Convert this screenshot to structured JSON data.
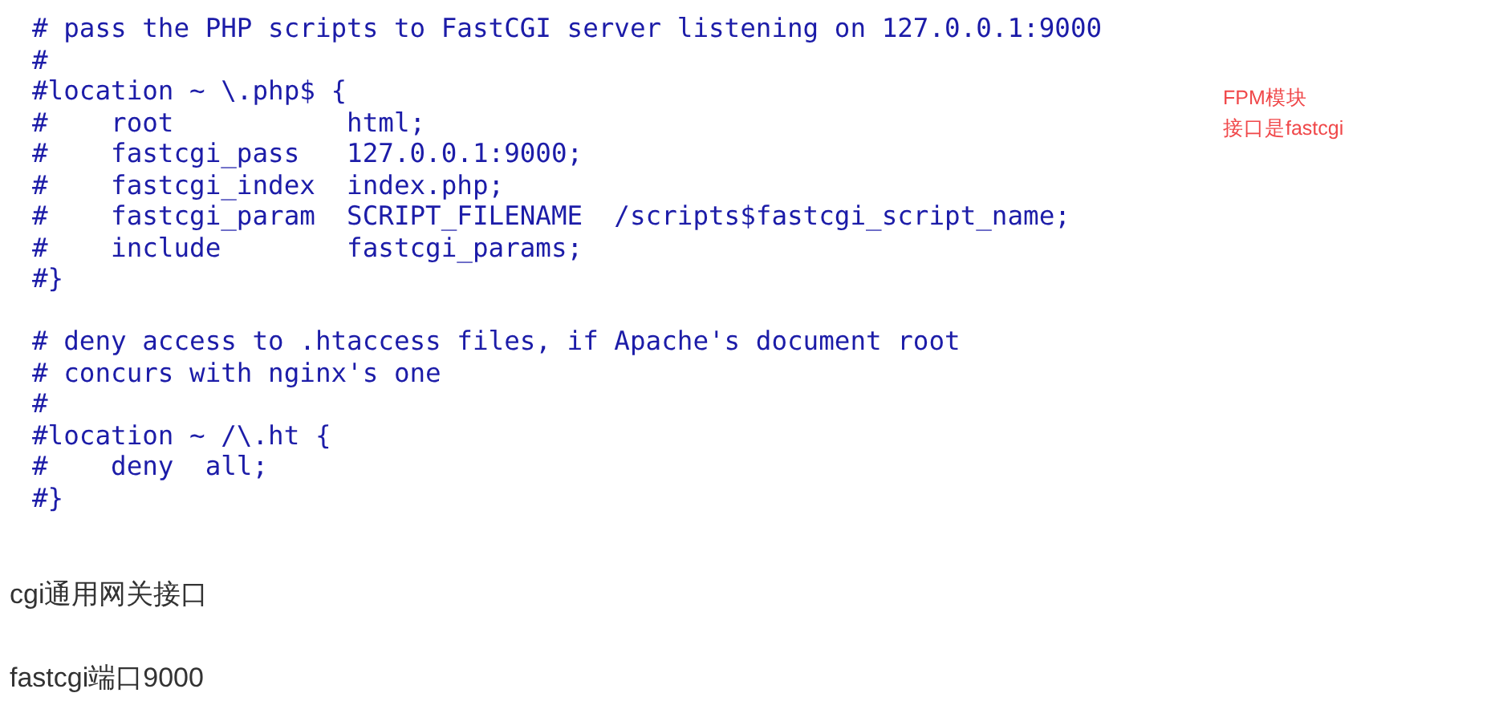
{
  "code_blocks": [
    [
      "# pass the PHP scripts to FastCGI server listening on 127.0.0.1:9000",
      "#",
      "#location ~ \\.php$ {",
      "#    root           html;",
      "#    fastcgi_pass   127.0.0.1:9000;",
      "#    fastcgi_index  index.php;",
      "#    fastcgi_param  SCRIPT_FILENAME  /scripts$fastcgi_script_name;",
      "#    include        fastcgi_params;",
      "#}"
    ],
    [
      "# deny access to .htaccess files, if Apache's document root",
      "# concurs with nginx's one",
      "#",
      "#location ~ /\\.ht {",
      "#    deny  all;",
      "#}"
    ]
  ],
  "annotation": [
    "FPM模块",
    "接口是fastcgi"
  ],
  "paragraphs": [
    "cgi通用网关接口",
    "fastcgi端口9000"
  ]
}
